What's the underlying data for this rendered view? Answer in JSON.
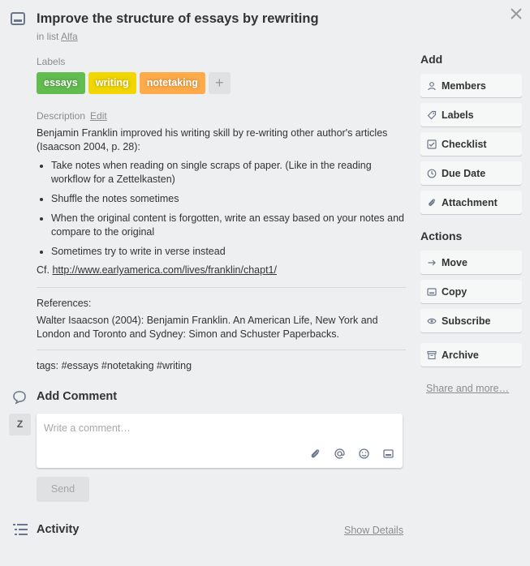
{
  "card": {
    "title": "Improve the structure of essays by rewriting",
    "in_list_prefix": "in list",
    "list_name": "Alfa"
  },
  "labels": {
    "heading": "Labels",
    "items": [
      {
        "text": "essays",
        "color": "#61bd4f"
      },
      {
        "text": "writing",
        "color": "#f2d600"
      },
      {
        "text": "notetaking",
        "color": "#ffab4a"
      }
    ],
    "add": "+"
  },
  "description": {
    "heading": "Description",
    "edit": "Edit",
    "intro": "Benjamin Franklin improved his writing skill by re-writing other author's articles (Isaacson 2004, p. 28):",
    "bullets": [
      "Take notes when reading on single scraps of paper. (Like in the reading workflow for a Zettelkasten)",
      "Shuffle the notes sometimes",
      "When the original content is forgotten, write an essay based on your notes and compare to the original",
      "Sometimes try to write in verse instead"
    ],
    "cf_prefix": "Cf.",
    "cf_link": "http://www.earlyamerica.com/lives/franklin/chapt1/",
    "references_label": "References:",
    "references_text": "Walter Isaacson (2004): Benjamin Franklin. An American Life, New York and London and Toronto and Sydney: Simon and Schuster Paperbacks.",
    "tags": "tags: #essays #notetaking #writing"
  },
  "comment": {
    "heading": "Add Comment",
    "avatar": "Z",
    "placeholder": "Write a comment…",
    "send": "Send"
  },
  "activity": {
    "heading": "Activity",
    "show_details": "Show Details"
  },
  "sidebar": {
    "add_heading": "Add",
    "add_buttons": [
      "Members",
      "Labels",
      "Checklist",
      "Due Date",
      "Attachment"
    ],
    "actions_heading": "Actions",
    "action_buttons": [
      "Move",
      "Copy",
      "Subscribe",
      "Archive"
    ],
    "share": "Share and more…"
  }
}
